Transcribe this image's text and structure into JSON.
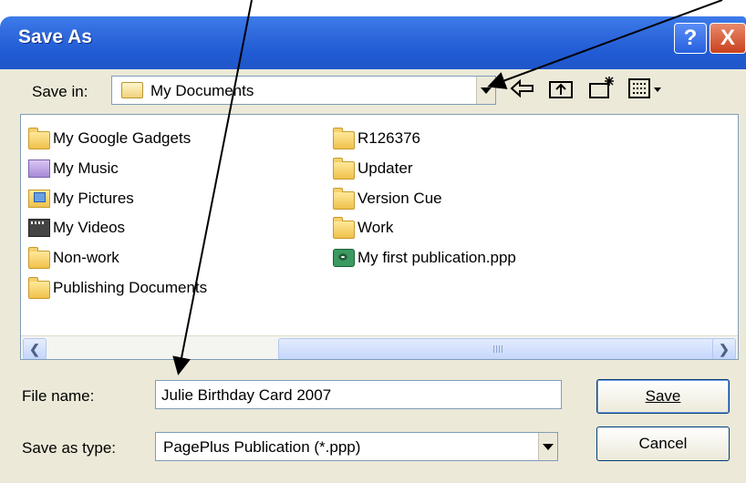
{
  "window": {
    "title": "Save As",
    "help_label": "?",
    "close_label": "X"
  },
  "save_in": {
    "label": "Save in:",
    "value": "My Documents",
    "toolbar_icons": [
      "back-icon",
      "up-folder-icon",
      "new-folder-icon",
      "view-menu-icon"
    ]
  },
  "files": [
    {
      "name": "My Google Gadgets",
      "icon": "folder-icon"
    },
    {
      "name": "My Music",
      "icon": "music-folder-icon"
    },
    {
      "name": "My Pictures",
      "icon": "pictures-folder-icon"
    },
    {
      "name": "My Videos",
      "icon": "videos-folder-icon"
    },
    {
      "name": "Non-work",
      "icon": "folder-icon"
    },
    {
      "name": "Publishing Documents",
      "icon": "folder-icon"
    },
    {
      "name": "R126376",
      "icon": "folder-icon"
    },
    {
      "name": "Updater",
      "icon": "folder-icon"
    },
    {
      "name": "Version Cue",
      "icon": "folder-icon"
    },
    {
      "name": "Work",
      "icon": "folder-icon"
    },
    {
      "name": "My first publication.ppp",
      "icon": "pageplus-file-icon"
    }
  ],
  "file_name": {
    "label": "File name:",
    "value": "Julie Birthday Card 2007"
  },
  "save_type": {
    "label": "Save as type:",
    "value": "PagePlus Publication (*.ppp)"
  },
  "buttons": {
    "save": "Save",
    "cancel": "Cancel"
  },
  "colors": {
    "titlebar": "#215bd4",
    "dialog_bg": "#ece9d8",
    "close_button": "#c9411d"
  }
}
